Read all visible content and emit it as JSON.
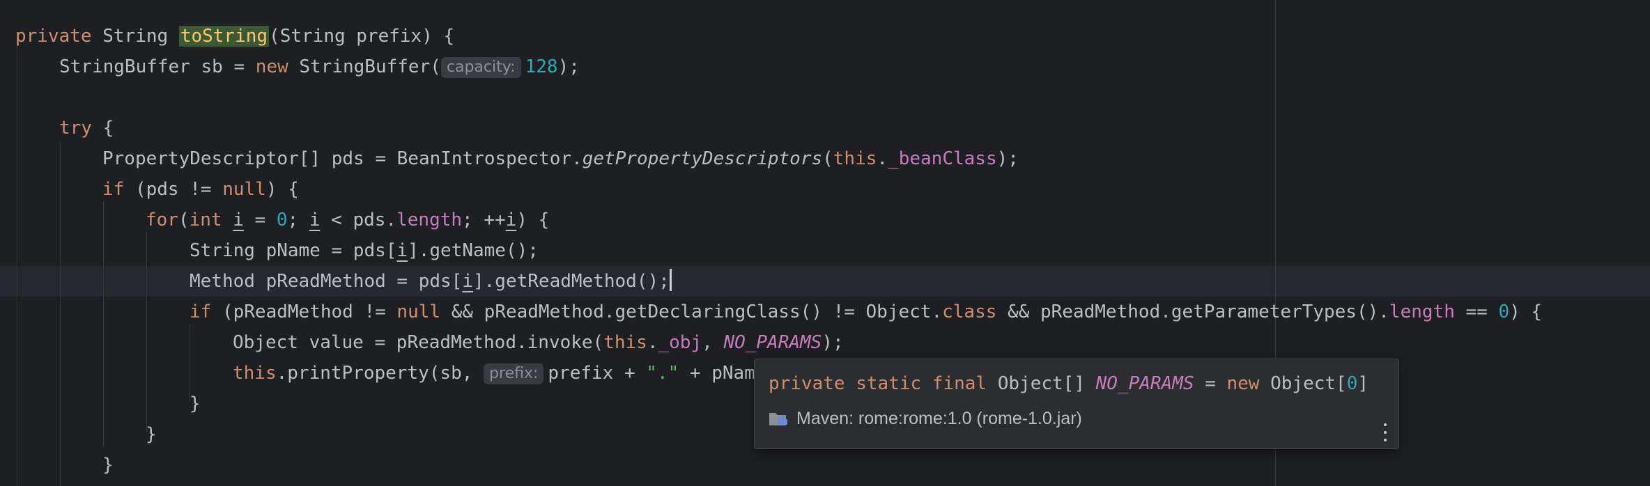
{
  "editor": {
    "line1": {
      "kw_private": "private",
      "type_string": "String",
      "method_name": "toString",
      "params": "(String prefix) {"
    },
    "line2": {
      "text_a": "StringBuffer sb = ",
      "kw_new": "new",
      "text_b": " StringBuffer(",
      "hint_capacity": "capacity:",
      "num_128": "128",
      "text_c": ");"
    },
    "line4": {
      "kw_try": "try",
      "text": " {"
    },
    "line5": {
      "text_a": "PropertyDescriptor[] pds = BeanIntrospector.",
      "method_static": "getPropertyDescriptors",
      "text_b": "(",
      "kw_this": "this",
      "text_c": ".",
      "field_beanclass": "_beanClass",
      "text_d": ");"
    },
    "line6": {
      "kw_if": "if",
      "text_a": " (pds != ",
      "kw_null": "null",
      "text_b": ") {"
    },
    "line7": {
      "kw_for": "for",
      "text_a": "(",
      "kw_int": "int",
      "text_b": " ",
      "var_i1": "i",
      "text_c": " = ",
      "num_0": "0",
      "text_d": "; ",
      "var_i2": "i",
      "text_e": " < pds.",
      "field_length": "length",
      "text_f": "; ++",
      "var_i3": "i",
      "text_g": ") {"
    },
    "line8": {
      "text_a": "String pName = pds[",
      "var_i": "i",
      "text_b": "].getName();"
    },
    "line9": {
      "text_a": "Method pReadMethod = pds[",
      "var_i": "i",
      "text_b": "].getReadMethod();"
    },
    "line10": {
      "kw_if": "if",
      "text_a": " (pReadMethod != ",
      "kw_null": "null",
      "text_b": " && pReadMethod.getDeclaringClass() != Object.",
      "kw_class": "class",
      "text_c": " && pReadMethod.getParameterTypes().",
      "field_length": "length",
      "text_d": " == ",
      "num_0": "0",
      "text_e": ") {"
    },
    "line11": {
      "text_a": "Object value = pReadMethod.invoke(",
      "kw_this": "this",
      "text_b": ".",
      "field_obj": "_obj",
      "text_c": ", ",
      "static_noparams": "NO_PARAMS",
      "text_d": ");"
    },
    "line12": {
      "kw_this": "this",
      "text_a": ".printProperty(sb, ",
      "hint_prefix": "prefix:",
      "text_b": "prefix + ",
      "str_dot": "\".\"",
      "text_c": " + pNam"
    },
    "line13": {
      "text": "}"
    },
    "line14": {
      "text": "}"
    },
    "line15": {
      "text": "}"
    }
  },
  "popup": {
    "sig_private": "private",
    "sig_static": "static",
    "sig_final": "final",
    "sig_type": "Object[]",
    "sig_name": "NO_PARAMS",
    "sig_eq": "=",
    "sig_new": "new",
    "sig_ctor": "Object[",
    "sig_num": "0",
    "sig_close": "]",
    "source": "Maven: rome:rome:1.0 (rome-1.0.jar)"
  }
}
